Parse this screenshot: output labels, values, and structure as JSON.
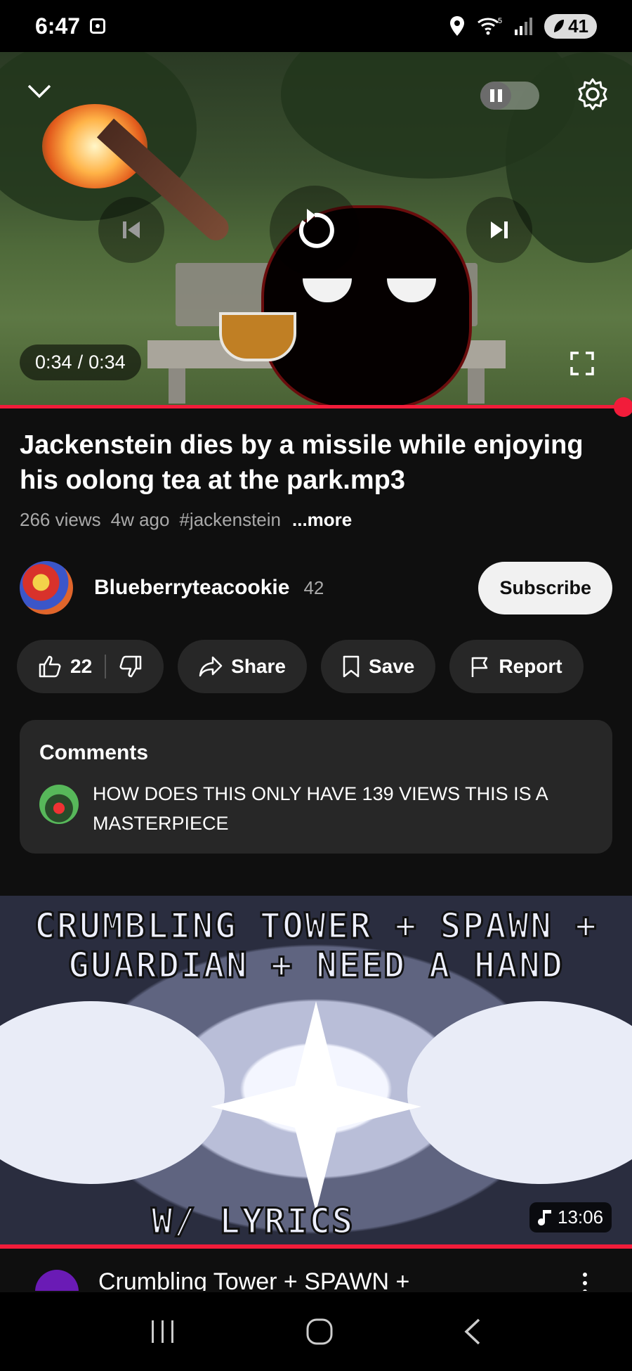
{
  "status_bar": {
    "time": "6:47",
    "battery": "41",
    "wifi_level": "5"
  },
  "player": {
    "current_time": "0:34",
    "separator": "/",
    "duration": "0:34",
    "progress": 1.0
  },
  "video": {
    "title": "Jackenstein dies by a missile while enjoying his oolong tea at the park.mp3",
    "views": "266 views",
    "age": "4w ago",
    "hashtag": "#jackenstein",
    "more": "...more"
  },
  "channel": {
    "name": "Blueberryteacookie",
    "subscribers": "42",
    "subscribe_label": "Subscribe"
  },
  "actions": {
    "likes": "22",
    "share": "Share",
    "save": "Save",
    "report": "Report"
  },
  "comments": {
    "heading": "Comments",
    "top_comment": "HOW DOES THIS ONLY HAVE 139 VIEWS THIS IS A MASTERPIECE"
  },
  "next_video": {
    "thumb_line1": "CRUMBLING TOWER + SPAWN +",
    "thumb_line2": "GUARDIAN + NEED A HAND",
    "thumb_line3": "W/ LYRICS",
    "duration": "13:06",
    "title": "Crumbling Tower + SPAWN +"
  }
}
